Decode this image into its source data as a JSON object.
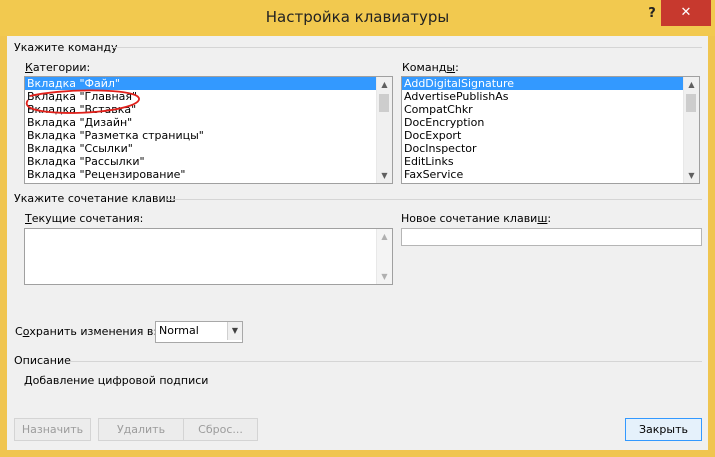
{
  "window": {
    "title": "Настройка клавиатуры",
    "help_label": "?",
    "close_label": "✕"
  },
  "command_group": {
    "title": "Укажите команду"
  },
  "categories": {
    "label": "Категории:",
    "items": [
      "Вкладка \"Файл\"",
      "Вкладка \"Главная\"",
      "Вкладка \"Вставка\"",
      "Вкладка \"Дизайн\"",
      "Вкладка \"Разметка страницы\"",
      "Вкладка \"Ссылки\"",
      "Вкладка \"Рассылки\"",
      "Вкладка \"Рецензирование\""
    ],
    "selected": 0
  },
  "commands": {
    "label": "Команды:",
    "items": [
      "AddDigitalSignature",
      "AdvertisePublishAs",
      "CompatChkr",
      "DocEncryption",
      "DocExport",
      "DocInspector",
      "EditLinks",
      "FaxService"
    ],
    "selected": 0
  },
  "shortcut_group": {
    "title": "Укажите сочетание клавиш"
  },
  "current_keys": {
    "label": "Текущие сочетания:"
  },
  "new_key": {
    "label": "Новое сочетание клавиш:",
    "value": ""
  },
  "save_in": {
    "label": "Сохранить изменения в:",
    "value": "Normal"
  },
  "description": {
    "title": "Описание",
    "text": "Добавление цифровой подписи"
  },
  "buttons": {
    "assign": "Назначить",
    "remove": "Удалить",
    "reset": "Сброс...",
    "close": "Закрыть"
  },
  "colors": {
    "titlebar": "#f2c94f",
    "selection": "#3399ff",
    "close_button": "#c7392e",
    "annotation": "#e0201a"
  }
}
